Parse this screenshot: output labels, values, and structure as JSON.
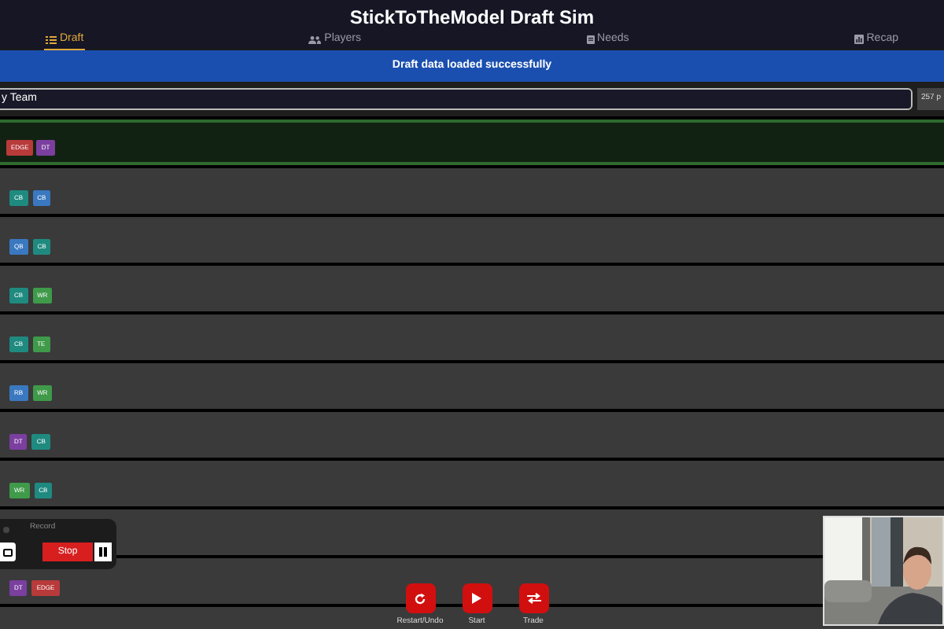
{
  "header": {
    "title": "StickToTheModel Draft Sim"
  },
  "tabs": [
    {
      "label": "Draft",
      "selected": true
    },
    {
      "label": "Players",
      "selected": false
    },
    {
      "label": "Needs",
      "selected": false
    },
    {
      "label": "Recap",
      "selected": false
    }
  ],
  "banner": "Draft data loaded successfully",
  "team_select": {
    "value": "y Team"
  },
  "pick_count": "257 p",
  "picks": [
    {
      "selected": true,
      "positions": [
        {
          "label": "EDGE",
          "color": "#b83a3a"
        },
        {
          "label": "DT",
          "color": "#7b3fa0"
        }
      ]
    },
    {
      "selected": false,
      "positions": [
        {
          "label": "CB",
          "color": "#1f8a80"
        },
        {
          "label": "CB",
          "color": "#3a78c0"
        }
      ]
    },
    {
      "selected": false,
      "positions": [
        {
          "label": "QB",
          "color": "#3a78c0"
        },
        {
          "label": "CB",
          "color": "#1f8a80"
        }
      ]
    },
    {
      "selected": false,
      "positions": [
        {
          "label": "CB",
          "color": "#1f8a80"
        },
        {
          "label": "WR",
          "color": "#3f9a4a"
        }
      ]
    },
    {
      "selected": false,
      "positions": [
        {
          "label": "CB",
          "color": "#1f8a80"
        },
        {
          "label": "TE",
          "color": "#3f9a4a"
        }
      ]
    },
    {
      "selected": false,
      "positions": [
        {
          "label": "RB",
          "color": "#3a78c0"
        },
        {
          "label": "WR",
          "color": "#3f9a4a"
        }
      ]
    },
    {
      "selected": false,
      "positions": [
        {
          "label": "DT",
          "color": "#7b3fa0"
        },
        {
          "label": "CB",
          "color": "#1f8a80"
        }
      ]
    },
    {
      "selected": false,
      "positions": [
        {
          "label": "WR",
          "color": "#3f9a4a"
        },
        {
          "label": "CB",
          "color": "#1f8a80"
        }
      ]
    },
    {
      "selected": false
    },
    {
      "selected": false,
      "positions": [
        {
          "label": "DT",
          "color": "#7b3fa0"
        },
        {
          "label": "EDGE",
          "color": "#b83a3a"
        }
      ]
    },
    {
      "selected": false
    }
  ],
  "recorder": {
    "title": "Record",
    "stop": "Stop"
  },
  "actions": [
    {
      "label": "Restart/Undo"
    },
    {
      "label": "Start"
    },
    {
      "label": "Trade"
    }
  ]
}
